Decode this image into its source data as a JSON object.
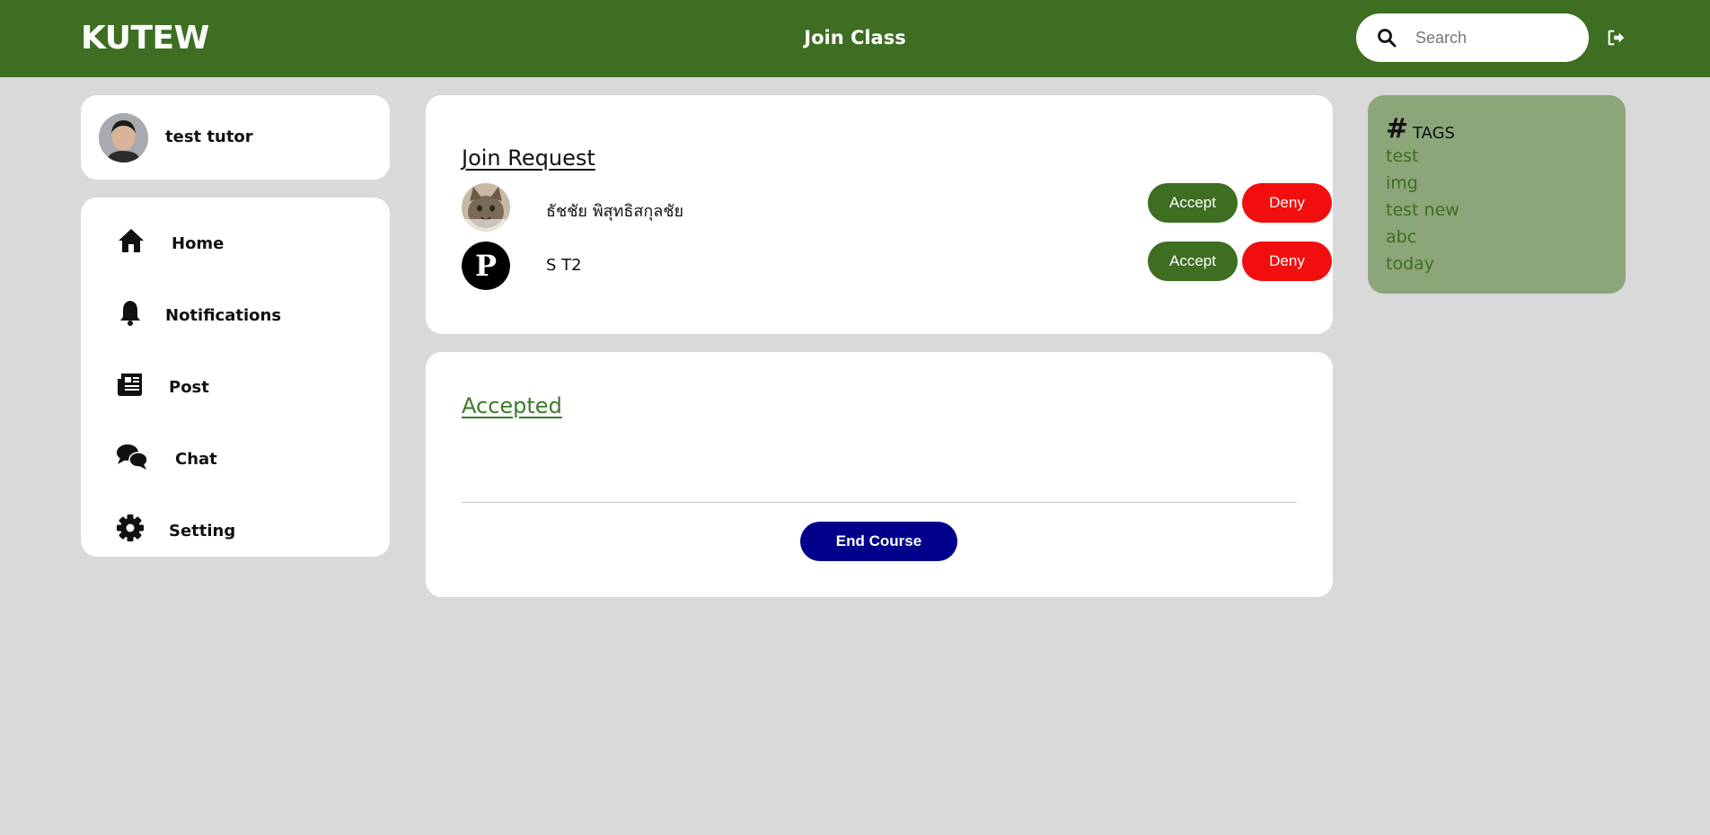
{
  "header": {
    "brand": "KUTEW",
    "page_title": "Join Class",
    "search_placeholder": "Search",
    "search_value": ""
  },
  "profile": {
    "name": "test tutor"
  },
  "nav": {
    "items": [
      {
        "label": "Home",
        "icon": "home-icon"
      },
      {
        "label": "Notifications",
        "icon": "bell-icon"
      },
      {
        "label": "Post",
        "icon": "newspaper-icon"
      },
      {
        "label": "Chat",
        "icon": "chat-icon"
      },
      {
        "label": "Setting",
        "icon": "gear-icon"
      }
    ]
  },
  "join_request": {
    "title": "Join Request",
    "accept_label": "Accept",
    "deny_label": "Deny",
    "requests": [
      {
        "name": "ธัชชัย พิสุทธิสกุลชัย",
        "avatar": "cat-photo"
      },
      {
        "name": "S T2",
        "avatar": "letter-p-avatar"
      }
    ]
  },
  "accepted": {
    "title": "Accepted",
    "end_course_label": "End Course"
  },
  "tags": {
    "title": "TAGS",
    "items": [
      "test",
      "img",
      "test new",
      "abc",
      "today"
    ]
  },
  "colors": {
    "brand_green": "#3d6e21",
    "deny_red": "#f20e0e",
    "end_course_navy": "#00008b",
    "tags_panel": "#8ca679",
    "background": "#d9d9d9"
  }
}
